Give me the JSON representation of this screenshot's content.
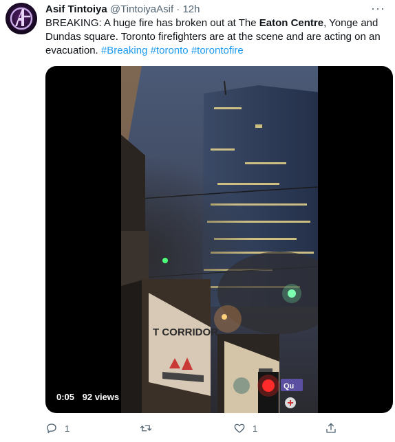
{
  "tweet": {
    "author_name": "Asif Tintoiya",
    "handle": "@TintoiyaAsif",
    "separator": "·",
    "time": "12h",
    "more_label": "···",
    "text_parts": {
      "p1": "BREAKING: A huge fire has broken out at The ",
      "bold": "Eaton Centre",
      "p2": ", Yonge and Dundas square. Toronto firefighters are at the scene and are acting on an evacuation. ",
      "tag1": "#Breaking",
      "tag2": "#toronto",
      "tag3": "#torontofire"
    }
  },
  "video": {
    "duration": "0:05",
    "views": "92 views",
    "sign_text_1": "T CORRIDOR",
    "sign_text_2": "Qu"
  },
  "actions": {
    "reply_count": "1",
    "retweet_count": "",
    "like_count": "1"
  },
  "icons": {
    "reply": "reply-icon",
    "retweet": "retweet-icon",
    "like": "heart-icon",
    "share": "share-icon",
    "avatar": "avengers-logo-icon"
  },
  "colors": {
    "link": "#1d9bf0",
    "secondary": "#536471",
    "text": "#0f1419"
  }
}
